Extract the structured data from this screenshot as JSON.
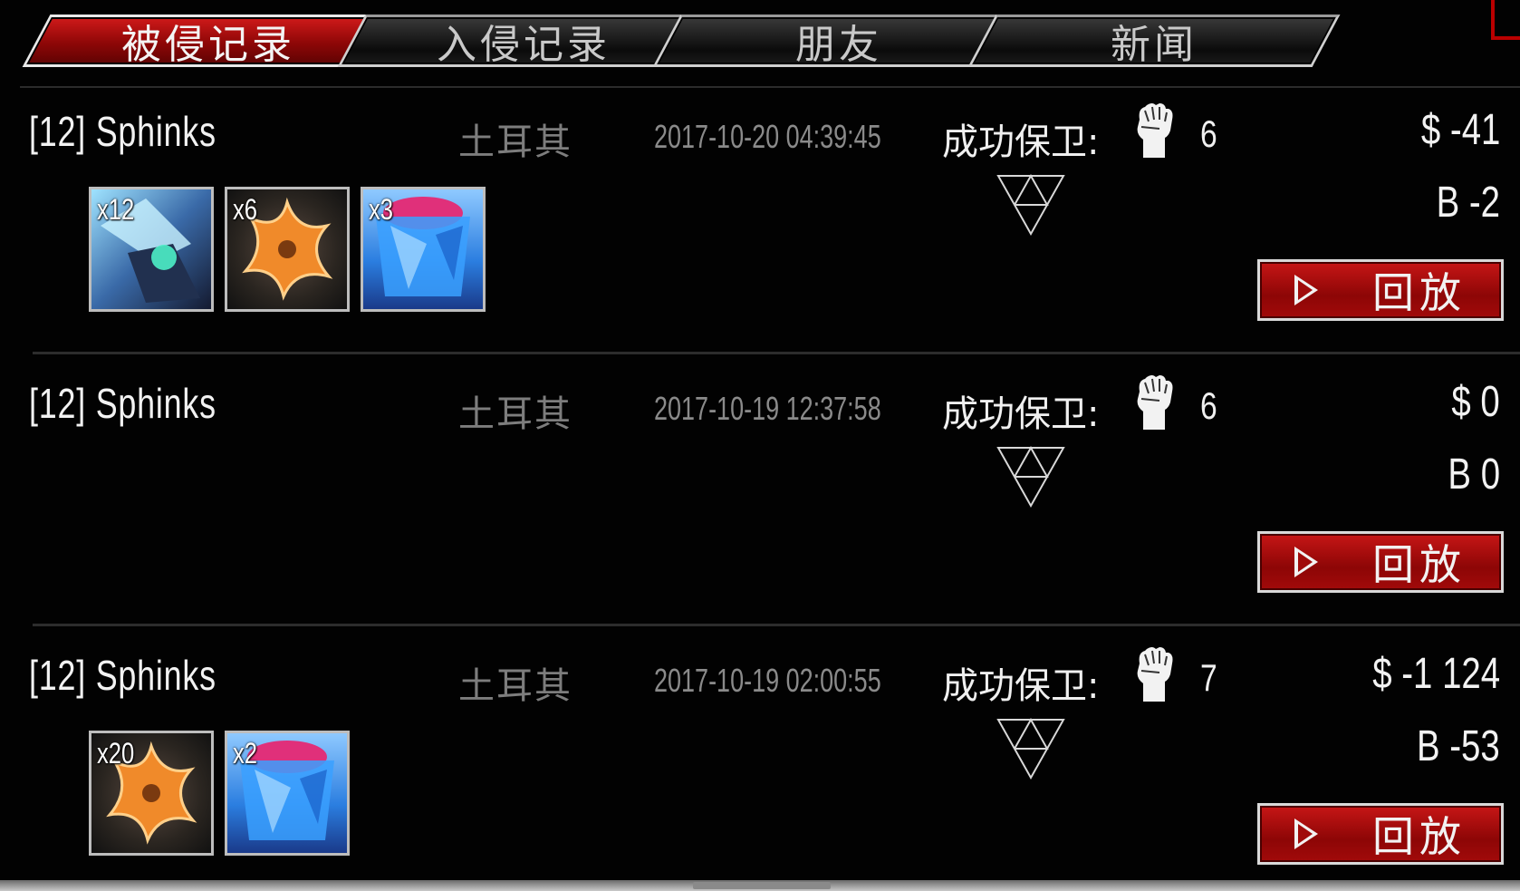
{
  "tabs": [
    {
      "label": "被侵记录",
      "active": true
    },
    {
      "label": "入侵记录",
      "active": false
    },
    {
      "label": "朋友",
      "active": false
    },
    {
      "label": "新闻",
      "active": false
    }
  ],
  "records": [
    {
      "player": "[12] Sphinks",
      "country": "土耳其",
      "date": "2017-10-20 04:39:45",
      "defend_label": "成功保卫:",
      "fist_count": "6",
      "money": "$ -41",
      "b_value": "B -2",
      "replay_label": "回放",
      "items": [
        {
          "type": "weapon",
          "qty": "x12"
        },
        {
          "type": "star",
          "qty": "x6"
        },
        {
          "type": "gem",
          "qty": "x3"
        }
      ]
    },
    {
      "player": "[12] Sphinks",
      "country": "土耳其",
      "date": "2017-10-19 12:37:58",
      "defend_label": "成功保卫:",
      "fist_count": "6",
      "money": "$ 0",
      "b_value": "B 0",
      "replay_label": "回放",
      "items": []
    },
    {
      "player": "[12] Sphinks",
      "country": "土耳其",
      "date": "2017-10-19 02:00:55",
      "defend_label": "成功保卫:",
      "fist_count": "7",
      "money": "$ -1 124",
      "b_value": "B -53",
      "replay_label": "回放",
      "items": [
        {
          "type": "star",
          "qty": "x20"
        },
        {
          "type": "gem",
          "qty": "x2"
        }
      ]
    }
  ],
  "colors": {
    "accent_red": "#b00d0d",
    "background": "#020202",
    "muted_text": "#7d7d7d"
  },
  "icons": {
    "fist": "fist-icon",
    "triangle": "triforce-icon",
    "play": "play-icon"
  }
}
